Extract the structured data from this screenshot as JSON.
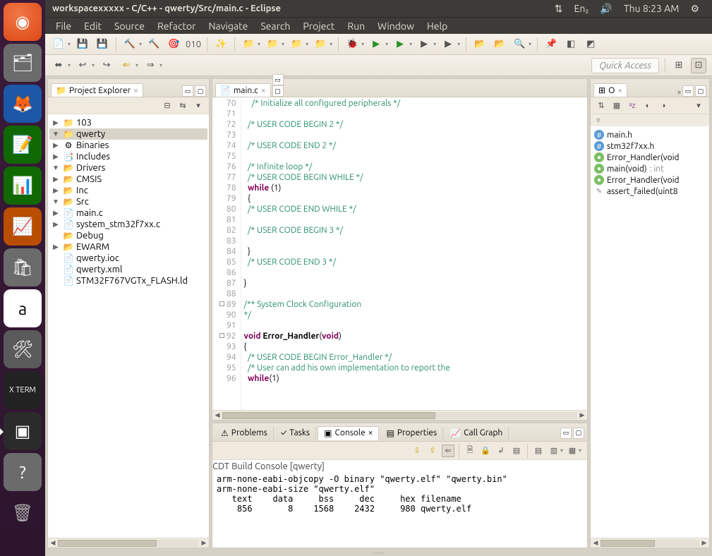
{
  "topbar": {
    "title": "workspacexxxxx - C/C++ - qwerty/Src/main.c - Eclipse",
    "keyboard": "En₂",
    "clock": "Thu  8:23 AM"
  },
  "menubar": [
    "File",
    "Edit",
    "Source",
    "Refactor",
    "Navigate",
    "Search",
    "Project",
    "Run",
    "Window",
    "Help"
  ],
  "quick_access": "Quick Access",
  "project_explorer": {
    "title": "Project Explorer",
    "tree": [
      {
        "d": 0,
        "tw": "▶",
        "ic": "📁",
        "label": "103"
      },
      {
        "d": 0,
        "tw": "▼",
        "ic": "📁",
        "label": "qwerty",
        "sel": true
      },
      {
        "d": 1,
        "tw": "▶",
        "ic": "⚙",
        "label": "Binaries"
      },
      {
        "d": 1,
        "tw": "▶",
        "ic": "📑",
        "label": "Includes"
      },
      {
        "d": 1,
        "tw": "▼",
        "ic": "📂",
        "label": "Drivers"
      },
      {
        "d": 2,
        "tw": "▶",
        "ic": "📂",
        "label": "CMSIS"
      },
      {
        "d": 1,
        "tw": "▶",
        "ic": "📂",
        "label": "Inc"
      },
      {
        "d": 1,
        "tw": "▼",
        "ic": "📂",
        "label": "Src"
      },
      {
        "d": 2,
        "tw": "▶",
        "ic": "📄",
        "label": "main.c"
      },
      {
        "d": 2,
        "tw": "▶",
        "ic": "📄",
        "label": "system_stm32f7xx.c"
      },
      {
        "d": 1,
        "tw": "",
        "ic": "📂",
        "label": "Debug"
      },
      {
        "d": 1,
        "tw": "▶",
        "ic": "📂",
        "label": "EWARM"
      },
      {
        "d": 2,
        "tw": "",
        "ic": "📄",
        "label": "qwerty.ioc"
      },
      {
        "d": 2,
        "tw": "",
        "ic": "📄",
        "label": "qwerty.xml"
      },
      {
        "d": 2,
        "tw": "",
        "ic": "📄",
        "label": "STM32F767VGTx_FLASH.ld"
      }
    ]
  },
  "editor": {
    "tab": "main.c",
    "first_line": 70,
    "lines": [
      {
        "cls": "c-cm",
        "txt": "  /* Initialize all configured peripherals */",
        "pre": "  "
      },
      {
        "cls": "",
        "txt": ""
      },
      {
        "cls": "c-cm",
        "txt": "/* USER CODE BEGIN 2 */",
        "pre": "  "
      },
      {
        "cls": "",
        "txt": ""
      },
      {
        "cls": "c-cm",
        "txt": "/* USER CODE END 2 */",
        "pre": "  "
      },
      {
        "cls": "",
        "txt": ""
      },
      {
        "cls": "c-cm",
        "txt": "/* Infinite loop */",
        "pre": "  "
      },
      {
        "cls": "c-cm",
        "txt": "/* USER CODE BEGIN WHILE */",
        "pre": "  "
      },
      {
        "raw": "  <span class='c-kw'>while</span> (1)"
      },
      {
        "raw": "  {"
      },
      {
        "cls": "c-cm",
        "txt": "/* USER CODE END WHILE */",
        "pre": "  "
      },
      {
        "cls": "",
        "txt": ""
      },
      {
        "cls": "c-cm",
        "txt": "/* USER CODE BEGIN 3 */",
        "pre": "  "
      },
      {
        "cls": "",
        "txt": ""
      },
      {
        "raw": "  }"
      },
      {
        "cls": "c-cm",
        "txt": "/* USER CODE END 3 */",
        "pre": "  "
      },
      {
        "cls": "",
        "txt": ""
      },
      {
        "raw": "}"
      },
      {
        "cls": "",
        "txt": ""
      },
      {
        "cls": "c-cm",
        "txt": "/** System Clock Configuration",
        "mark": true
      },
      {
        "cls": "c-cm",
        "txt": "*/"
      },
      {
        "cls": "",
        "txt": ""
      },
      {
        "raw": "<span class='c-kw'>void</span> <span class='c-fn'>Error_Handler</span>(<span class='c-kw'>void</span>)",
        "mark": true
      },
      {
        "raw": "{"
      },
      {
        "cls": "c-cm",
        "txt": "/* USER CODE BEGIN Error_Handler */",
        "pre": "  "
      },
      {
        "cls": "c-cm",
        "txt": "/* User can add his own implementation to report the",
        "pre": "  "
      },
      {
        "raw": "  <span class='c-kw'>while</span>(1)"
      }
    ]
  },
  "outline": {
    "title": "O",
    "items": [
      {
        "k": "h",
        "label": "main.h"
      },
      {
        "k": "h",
        "label": "stm32f7xx.h"
      },
      {
        "k": "g",
        "label": "Error_Handler(void"
      },
      {
        "k": "g",
        "label": "main(void)",
        "ret": ": int"
      },
      {
        "k": "g",
        "label": "Error_Handler(void"
      },
      {
        "k": "x",
        "label": "assert_failed(uint8"
      }
    ]
  },
  "bottom": {
    "tabs": [
      "Problems",
      "Tasks",
      "Console",
      "Properties",
      "Call Graph"
    ],
    "active": 2,
    "console_title": "CDT Build Console [qwerty]",
    "console_lines": [
      "arm-none-eabi-objcopy -O binary \"qwerty.elf\" \"qwerty.bin\"",
      "arm-none-eabi-size \"qwerty.elf\"",
      "   text    data     bss     dec     hex filename",
      "    856       8    1568    2432     980 qwerty.elf"
    ]
  },
  "launcher": [
    {
      "cls": "ubuntu",
      "g": "◉"
    },
    {
      "cls": "off",
      "g": "🗂"
    },
    {
      "cls": "fx",
      "g": "🦊"
    },
    {
      "cls": "lo1",
      "g": "📝"
    },
    {
      "cls": "lo2",
      "g": "📊"
    },
    {
      "cls": "lo3",
      "g": "📈"
    },
    {
      "cls": "off",
      "g": "🛍"
    },
    {
      "cls": "am",
      "g": "a"
    },
    {
      "cls": "set",
      "g": "🛠"
    },
    {
      "cls": "xt",
      "g": "X\nTERM"
    },
    {
      "cls": "term active",
      "g": "▣"
    },
    {
      "cls": "q",
      "g": "?"
    },
    {
      "cls": "trash",
      "g": "🗑"
    }
  ]
}
